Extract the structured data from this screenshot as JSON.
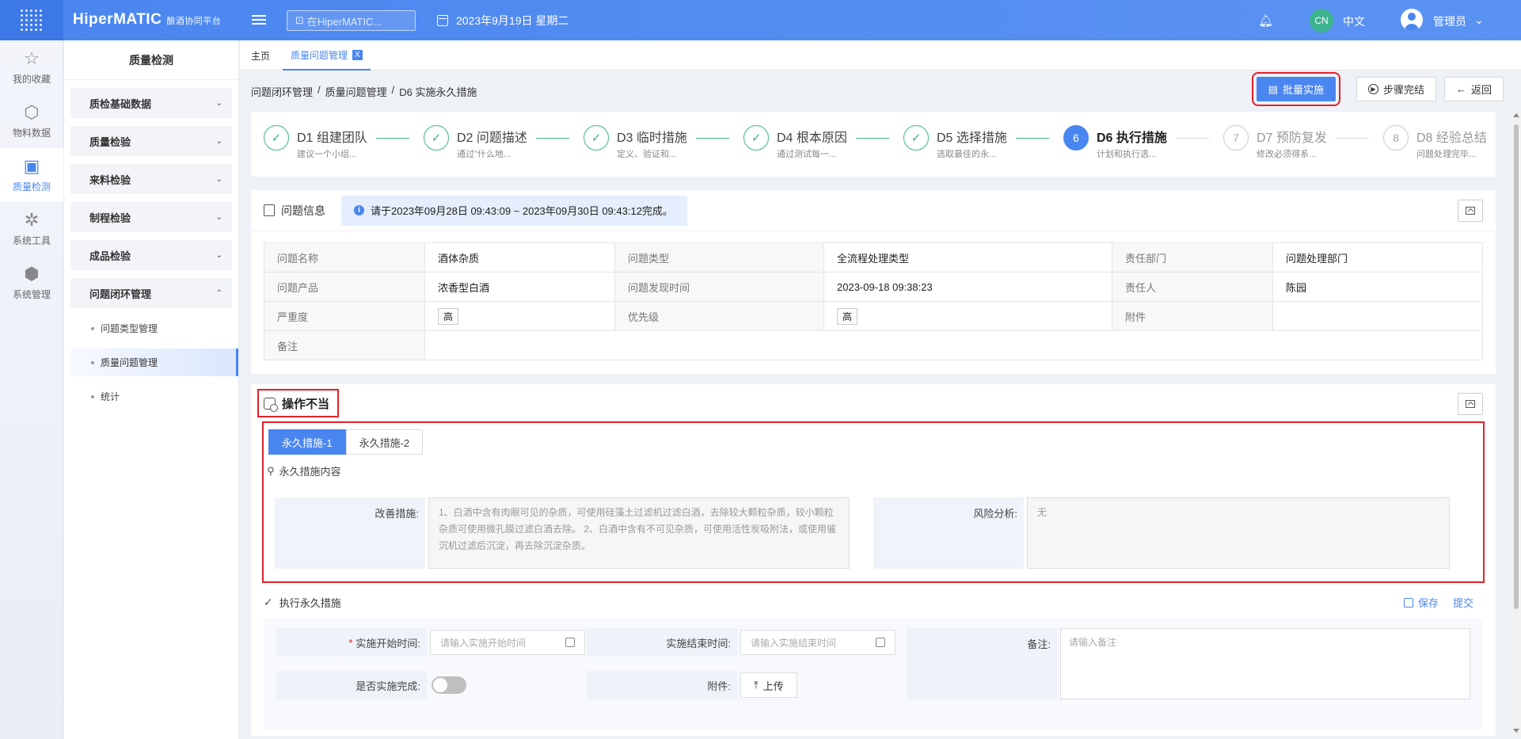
{
  "header": {
    "brand": "HiperMATIC",
    "brand_sub": "酿酒协同平台",
    "search_placeholder": "在HiperMATIC...",
    "date": "2023年9月19日 星期二",
    "lang_badge": "CN",
    "lang": "中文",
    "user": "管理员"
  },
  "rail": [
    {
      "label": "我的收藏",
      "icon": "star-icon"
    },
    {
      "label": "物料数据",
      "icon": "cube-icon"
    },
    {
      "label": "质量检测",
      "icon": "shield-check-icon"
    },
    {
      "label": "系统工具",
      "icon": "network-icon"
    },
    {
      "label": "系统管理",
      "icon": "settings-cube-icon"
    }
  ],
  "submenu": {
    "title": "质量检测",
    "groups": [
      "质检基础数据",
      "质量检验",
      "来料检验",
      "制程检验",
      "成品检验",
      "问题闭环管理"
    ],
    "items": [
      "问题类型管理",
      "质量问题管理",
      "统计"
    ]
  },
  "tabs": {
    "home": "主页",
    "current": "质量问题管理",
    "close": "X"
  },
  "breadcrumb": [
    "问题闭环管理",
    "/",
    "质量问题管理",
    "/",
    "D6 实施永久措施"
  ],
  "actions": {
    "batch": "批量实施",
    "step_done": "步骤完结",
    "back": "返回"
  },
  "steps": [
    {
      "mark": "✓",
      "title": "D1 组建团队",
      "desc": "建议一个小组..."
    },
    {
      "mark": "✓",
      "title": "D2 问题描述",
      "desc": "通过\"什么地..."
    },
    {
      "mark": "✓",
      "title": "D3 临时措施",
      "desc": "定义、验证和..."
    },
    {
      "mark": "✓",
      "title": "D4 根本原因",
      "desc": "通过测试每一..."
    },
    {
      "mark": "✓",
      "title": "D5 选择措施",
      "desc": "选取最佳的永..."
    },
    {
      "mark": "6",
      "title": "D6 执行措施",
      "desc": "计划和执行选..."
    },
    {
      "mark": "7",
      "title": "D7 预防复发",
      "desc": "修改必须得系..."
    },
    {
      "mark": "8",
      "title": "D8 经验总结",
      "desc": "问题处理完毕..."
    }
  ],
  "info": {
    "title": "问题信息",
    "notice": "请于2023年09月28日 09:43:09 ~ 2023年09月30日 09:43:12完成。",
    "rows": [
      [
        "问题名称",
        "酒体杂质",
        "问题类型",
        "全流程处理类型",
        "责任部门",
        "问题处理部门"
      ],
      [
        "问题产品",
        "浓香型白酒",
        "问题发现时间",
        "2023-09-18 09:38:23",
        "责任人",
        "陈园"
      ],
      [
        "严重度",
        "高",
        "优先级",
        "高",
        "附件",
        ""
      ],
      [
        "备注",
        ""
      ]
    ]
  },
  "operation": {
    "title": "操作不当",
    "subtabs": [
      "永久措施-1",
      "永久措施-2"
    ],
    "section": "永久措施内容",
    "improve_label": "改善措施:",
    "improve_text": "1、白酒中含有肉眼可见的杂质，可使用硅藻土过滤机过滤白酒，去除较大颗粒杂质，较小颗粒杂质可使用微孔膜过滤白酒去除。 2、白酒中含有不可见杂质，可使用活性炭吸附法，或使用催沉机过滤后沉淀，再去除沉淀杂质。",
    "risk_label": "风险分析:",
    "risk_text": "无"
  },
  "exec": {
    "title": "执行永久措施",
    "save": "保存",
    "submit": "提交",
    "start_label": "实施开始时间:",
    "start_required": "*",
    "start_placeholder": "请输入实施开始时间",
    "end_label": "实施结束时间:",
    "end_placeholder": "请输入实施结束时间",
    "remark_label": "备注:",
    "remark_placeholder": "请输入备注",
    "done_label": "是否实施完成:",
    "done_value": false,
    "attach_label": "附件:",
    "upload": "上传"
  },
  "colors": {
    "accent": "#4a86ef",
    "done": "#3eb58b",
    "highlight": "#e5202a"
  }
}
